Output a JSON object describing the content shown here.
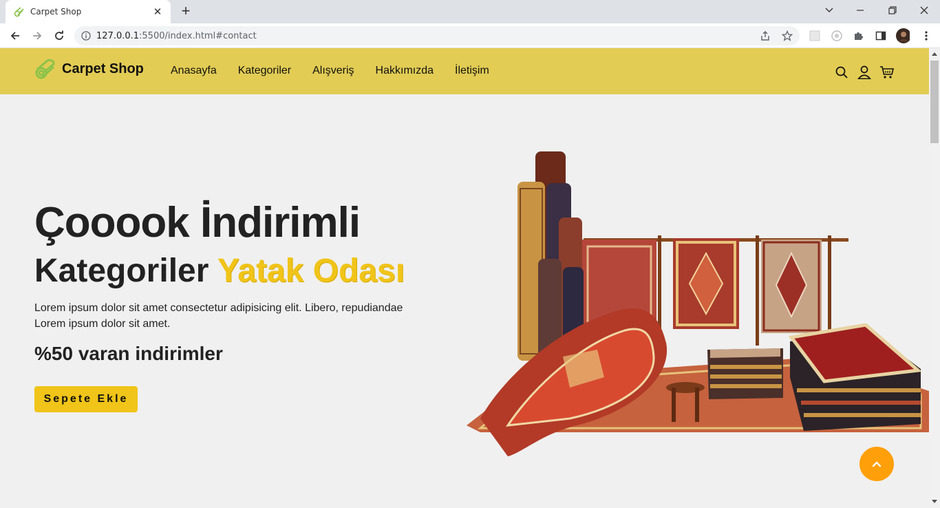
{
  "browser": {
    "tab_title": "Carpet Shop",
    "url_host": "127.0.0.1",
    "url_rest": ":5500/index.html#contact",
    "new_tab_symbol": "+",
    "close_tab_symbol": "✕"
  },
  "header": {
    "brand": "Carpet Shop",
    "menu": [
      "Anasayfa",
      "Kategoriler",
      "Alışveriş",
      "Hakkımızda",
      "İletişim"
    ],
    "icons": [
      "search-icon",
      "user-icon",
      "cart-icon"
    ]
  },
  "hero": {
    "title": "Çooook İndirimli",
    "subtitle_plain": "Kategoriler",
    "subtitle_accent": "Yatak Odası",
    "description": "Lorem ipsum dolor sit amet consectetur adipisicing elit. Libero, repudiandae Lorem ipsum dolor sit amet.",
    "discount": "%50 varan indirimler",
    "cta_label": "Sepete Ekle"
  },
  "colors": {
    "header_bg": "#e2cc54",
    "accent": "#f0c419",
    "scroll_top": "#ff9f0a"
  }
}
